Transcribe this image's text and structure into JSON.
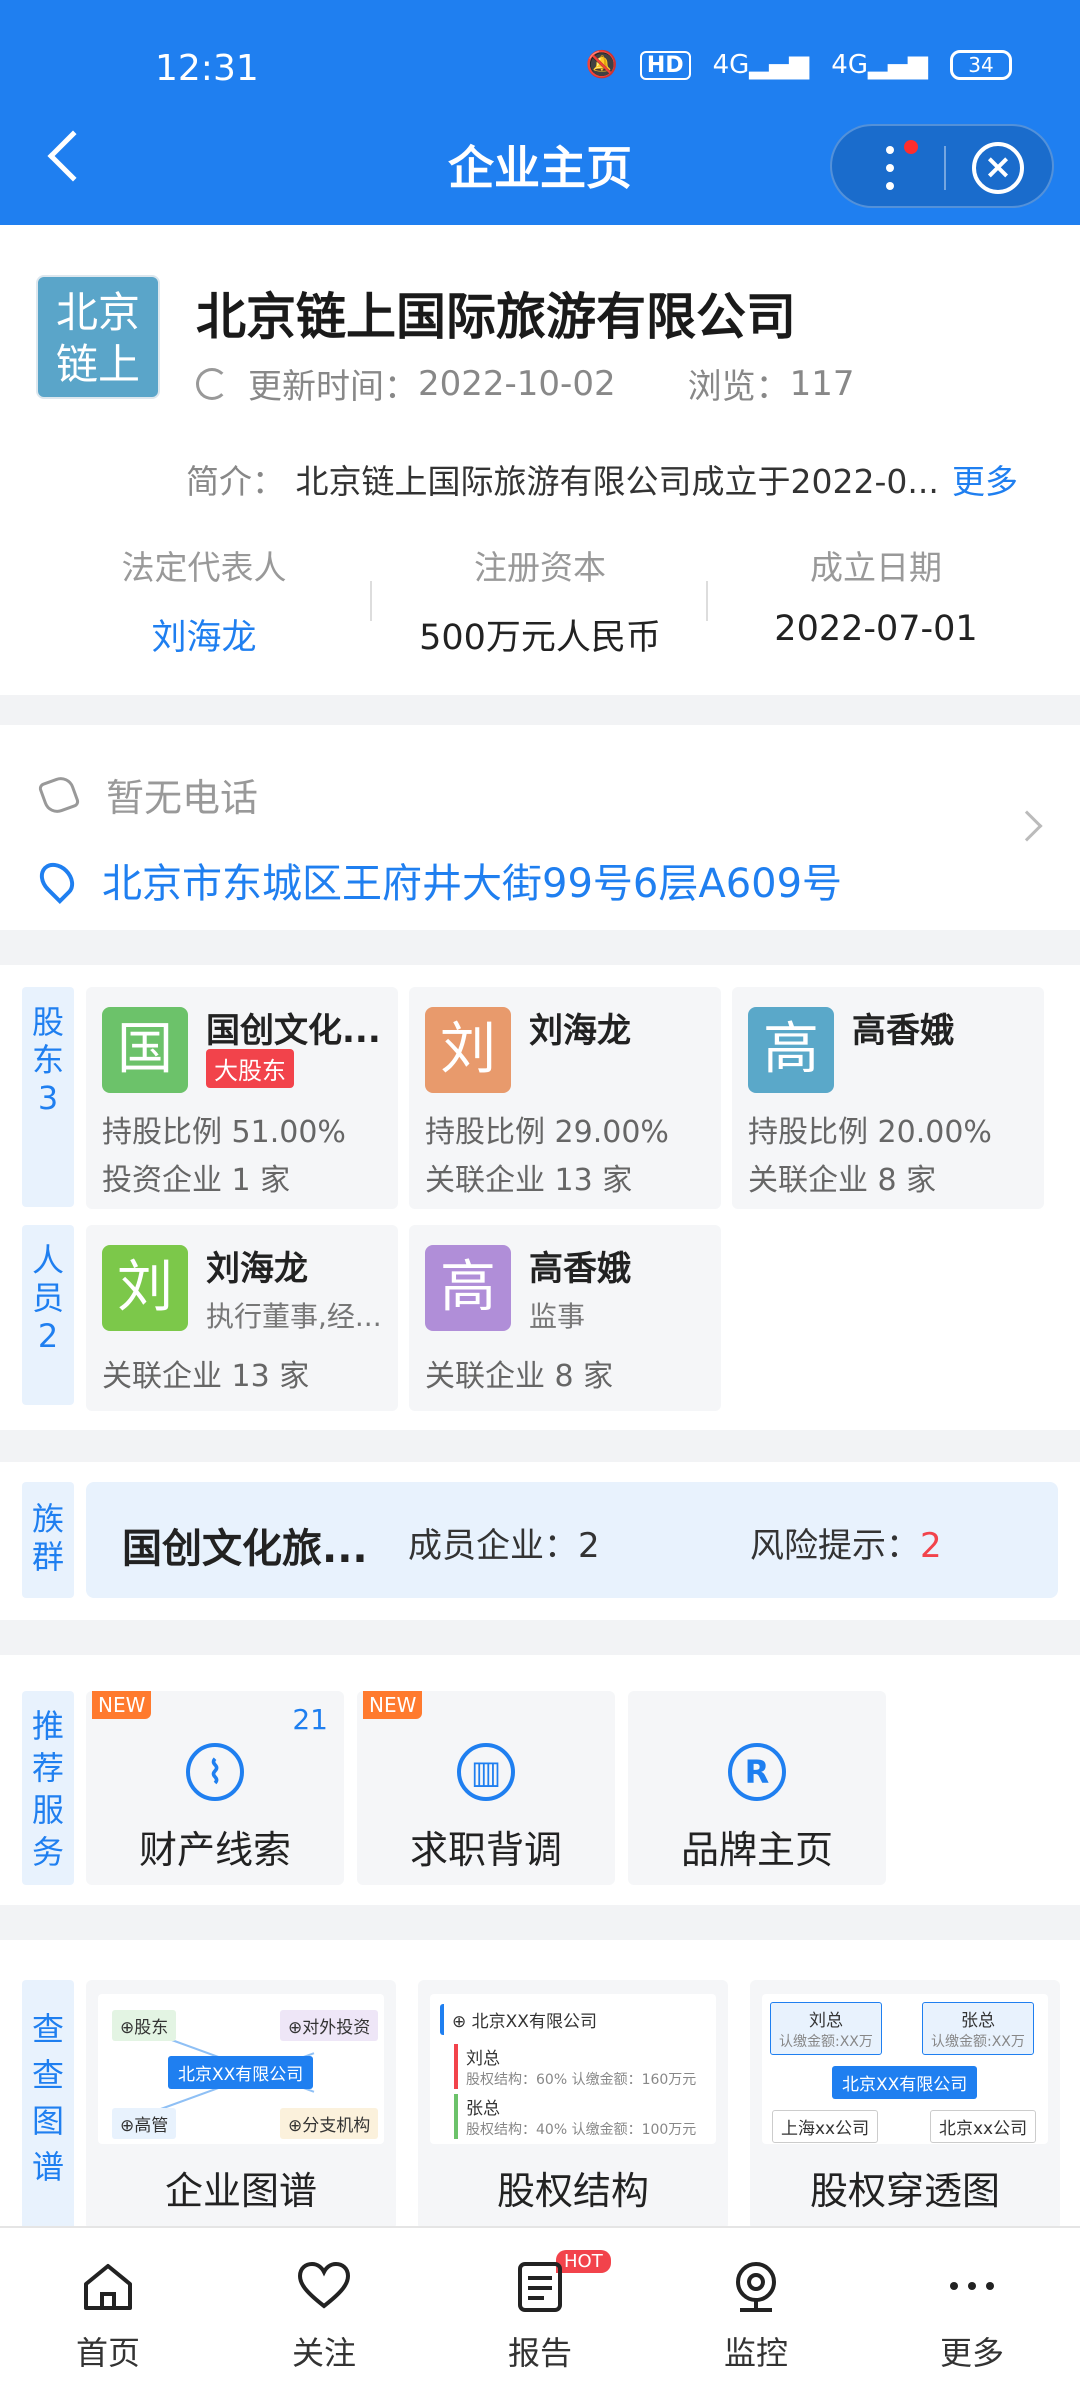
{
  "status_bar": {
    "time": "12:31",
    "network1": "4G",
    "network2": "4G",
    "hd": "HD",
    "battery": "34"
  },
  "header": {
    "title": "企业主页"
  },
  "company": {
    "logo_text": "北京链上",
    "name": "北京链上国际旅游有限公司",
    "update_label": "更新时间：",
    "update_value": "2022-10-02",
    "views_label": "浏览：",
    "views_value": "117",
    "intro_label": "简介：",
    "intro_text": "北京链上国际旅游有限公司成立于2022-0...",
    "more": "更多",
    "facts": [
      {
        "label": "法定代表人",
        "value": "刘海龙"
      },
      {
        "label": "注册资本",
        "value": "500万元人民币"
      },
      {
        "label": "成立日期",
        "value": "2022-07-01"
      }
    ]
  },
  "contact": {
    "phone": "暂无电话",
    "address": "北京市东城区王府井大街99号6层A609号"
  },
  "shareholders": {
    "tab": "股东3",
    "cards": [
      {
        "avatar": "国",
        "avatar_color": "#6cc26a",
        "name": "国创文化...",
        "badge": "大股东",
        "line1": "持股比例 51.00%",
        "line2": "投资企业 1 家"
      },
      {
        "avatar": "刘",
        "avatar_color": "#e89a6c",
        "name": "刘海龙",
        "line1": "持股比例 29.00%",
        "line2": "关联企业 13 家"
      },
      {
        "avatar": "高",
        "avatar_color": "#5aa8c9",
        "name": "高香娥",
        "line1": "持股比例 20.00%",
        "line2": "关联企业 8 家"
      }
    ]
  },
  "staff": {
    "tab": "人员2",
    "cards": [
      {
        "avatar": "刘",
        "avatar_color": "#7cc84a",
        "name": "刘海龙",
        "role": "执行董事,经...",
        "line": "关联企业 13 家"
      },
      {
        "avatar": "高",
        "avatar_color": "#b08ed8",
        "name": "高香娥",
        "role": "监事",
        "line": "关联企业 8 家"
      }
    ]
  },
  "group": {
    "tab": "族群",
    "name": "国创文化旅...",
    "members_label": "成员企业：",
    "members_value": "2",
    "risk_label": "风险提示：",
    "risk_value": "2"
  },
  "services": {
    "tab": "推荐服务",
    "items": [
      {
        "label": "财产线索",
        "badge": "NEW",
        "count": "21",
        "icon": "clue-icon"
      },
      {
        "label": "求职背调",
        "badge": "NEW",
        "icon": "building-search-icon"
      },
      {
        "label": "品牌主页",
        "icon": "registered-icon"
      }
    ]
  },
  "graphs": {
    "tab": "查查图谱",
    "items": [
      {
        "label": "企业图谱",
        "preview": {
          "center": "北京XX有限公司",
          "tl": "⊕股东",
          "tr": "⊕对外投资",
          "bl": "⊕高管",
          "br": "⊕分支机构"
        }
      },
      {
        "label": "股权结构",
        "preview": {
          "top": "⊕ 北京XX有限公司",
          "p1": "刘总",
          "p1_detail": "股权结构：60% 认缴金额：160万元",
          "p2": "张总",
          "p2_detail": "股权结构：40% 认缴金额：100万元"
        }
      },
      {
        "label": "股权穿透图",
        "preview": {
          "a": "刘总",
          "a_sub": "认缴金额:XX万",
          "b": "张总",
          "b_sub": "认缴金额:XX万",
          "center": "北京XX有限公司",
          "c": "上海xx公司",
          "d": "北京xx公司"
        }
      }
    ]
  },
  "bottom_nav": [
    {
      "label": "首页",
      "icon": "home-icon"
    },
    {
      "label": "关注",
      "icon": "heart-icon"
    },
    {
      "label": "报告",
      "icon": "report-icon",
      "badge": "HOT"
    },
    {
      "label": "监控",
      "icon": "monitor-icon"
    },
    {
      "label": "更多",
      "icon": "more-icon"
    }
  ]
}
